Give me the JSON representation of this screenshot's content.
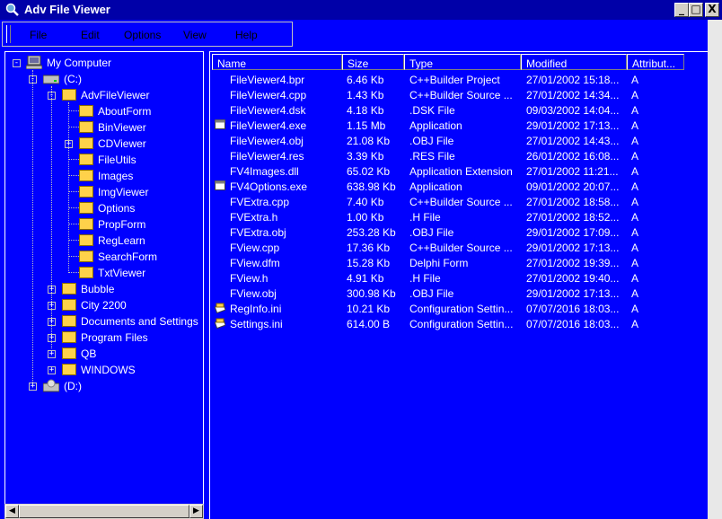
{
  "window": {
    "title": "Adv File Viewer",
    "buttons": {
      "minimize": "_",
      "maximize": "□",
      "close": "X"
    }
  },
  "menu": [
    {
      "label": "File"
    },
    {
      "label": "Edit"
    },
    {
      "label": "Options"
    },
    {
      "label": "View"
    },
    {
      "label": "Help"
    }
  ],
  "tree": {
    "root": "My Computer",
    "drive_c": "(C:)",
    "advfileviewer": "AdvFileViewer",
    "subfolders": [
      "AboutForm",
      "BinViewer",
      "CDViewer",
      "FileUtils",
      "Images",
      "ImgViewer",
      "Options",
      "PropForm",
      "RegLearn",
      "SearchForm",
      "TxtViewer"
    ],
    "c_folders": [
      "Bubble",
      "City 2200",
      "Documents and Settings",
      "Program Files",
      "QB",
      "WINDOWS"
    ],
    "drive_d": "(D:)"
  },
  "list": {
    "columns": [
      "Name",
      "Size",
      "Type",
      "Modified",
      "Attribut..."
    ],
    "rows": [
      {
        "name": "FileViewer4.bpr",
        "size": "6.46 Kb",
        "type": "C++Builder Project",
        "modified": "27/01/2002 15:18...",
        "attr": "A",
        "icon": "none"
      },
      {
        "name": "FileViewer4.cpp",
        "size": "1.43 Kb",
        "type": "C++Builder Source ...",
        "modified": "27/01/2002 14:34...",
        "attr": "A",
        "icon": "none"
      },
      {
        "name": "FileViewer4.dsk",
        "size": "4.18 Kb",
        "type": ".DSK File",
        "modified": "09/03/2002 14:04...",
        "attr": "A",
        "icon": "none"
      },
      {
        "name": "FileViewer4.exe",
        "size": "1.15 Mb",
        "type": "Application",
        "modified": "29/01/2002 17:13...",
        "attr": "A",
        "icon": "app-window-icon"
      },
      {
        "name": "FileViewer4.obj",
        "size": "21.08 Kb",
        "type": ".OBJ File",
        "modified": "27/01/2002 14:43...",
        "attr": "A",
        "icon": "none"
      },
      {
        "name": "FileViewer4.res",
        "size": "3.39 Kb",
        "type": ".RES File",
        "modified": "26/01/2002 16:08...",
        "attr": "A",
        "icon": "none"
      },
      {
        "name": "FV4Images.dll",
        "size": "65.02 Kb",
        "type": "Application Extension",
        "modified": "27/01/2002 11:21...",
        "attr": "A",
        "icon": "none"
      },
      {
        "name": "FV4Options.exe",
        "size": "638.98 Kb",
        "type": "Application",
        "modified": "09/01/2002 20:07...",
        "attr": "A",
        "icon": "app-window-icon"
      },
      {
        "name": "FVExtra.cpp",
        "size": "7.40 Kb",
        "type": "C++Builder Source ...",
        "modified": "27/01/2002 18:58...",
        "attr": "A",
        "icon": "none"
      },
      {
        "name": "FVExtra.h",
        "size": "1.00 Kb",
        "type": ".H File",
        "modified": "27/01/2002 18:52...",
        "attr": "A",
        "icon": "none"
      },
      {
        "name": "FVExtra.obj",
        "size": "253.28 Kb",
        "type": ".OBJ File",
        "modified": "29/01/2002 17:09...",
        "attr": "A",
        "icon": "none"
      },
      {
        "name": "FView.cpp",
        "size": "17.36 Kb",
        "type": "C++Builder Source ...",
        "modified": "29/01/2002 17:13...",
        "attr": "A",
        "icon": "none"
      },
      {
        "name": "FView.dfm",
        "size": "15.28 Kb",
        "type": "Delphi Form",
        "modified": "27/01/2002 19:39...",
        "attr": "A",
        "icon": "none"
      },
      {
        "name": "FView.h",
        "size": "4.91 Kb",
        "type": ".H File",
        "modified": "27/01/2002 19:40...",
        "attr": "A",
        "icon": "none"
      },
      {
        "name": "FView.obj",
        "size": "300.98 Kb",
        "type": ".OBJ File",
        "modified": "29/01/2002 17:13...",
        "attr": "A",
        "icon": "none"
      },
      {
        "name": "RegInfo.ini",
        "size": "10.21 Kb",
        "type": "Configuration Settin...",
        "modified": "07/07/2016 18:03...",
        "attr": "A",
        "icon": "config-file-icon"
      },
      {
        "name": "Settings.ini",
        "size": "614.00 B",
        "type": "Configuration Settin...",
        "modified": "07/07/2016 18:03...",
        "attr": "A",
        "icon": "config-file-icon"
      }
    ]
  },
  "colors": {
    "background": "#0000ff",
    "titlebar": "#0000a8",
    "folder": "#ffd24a"
  }
}
